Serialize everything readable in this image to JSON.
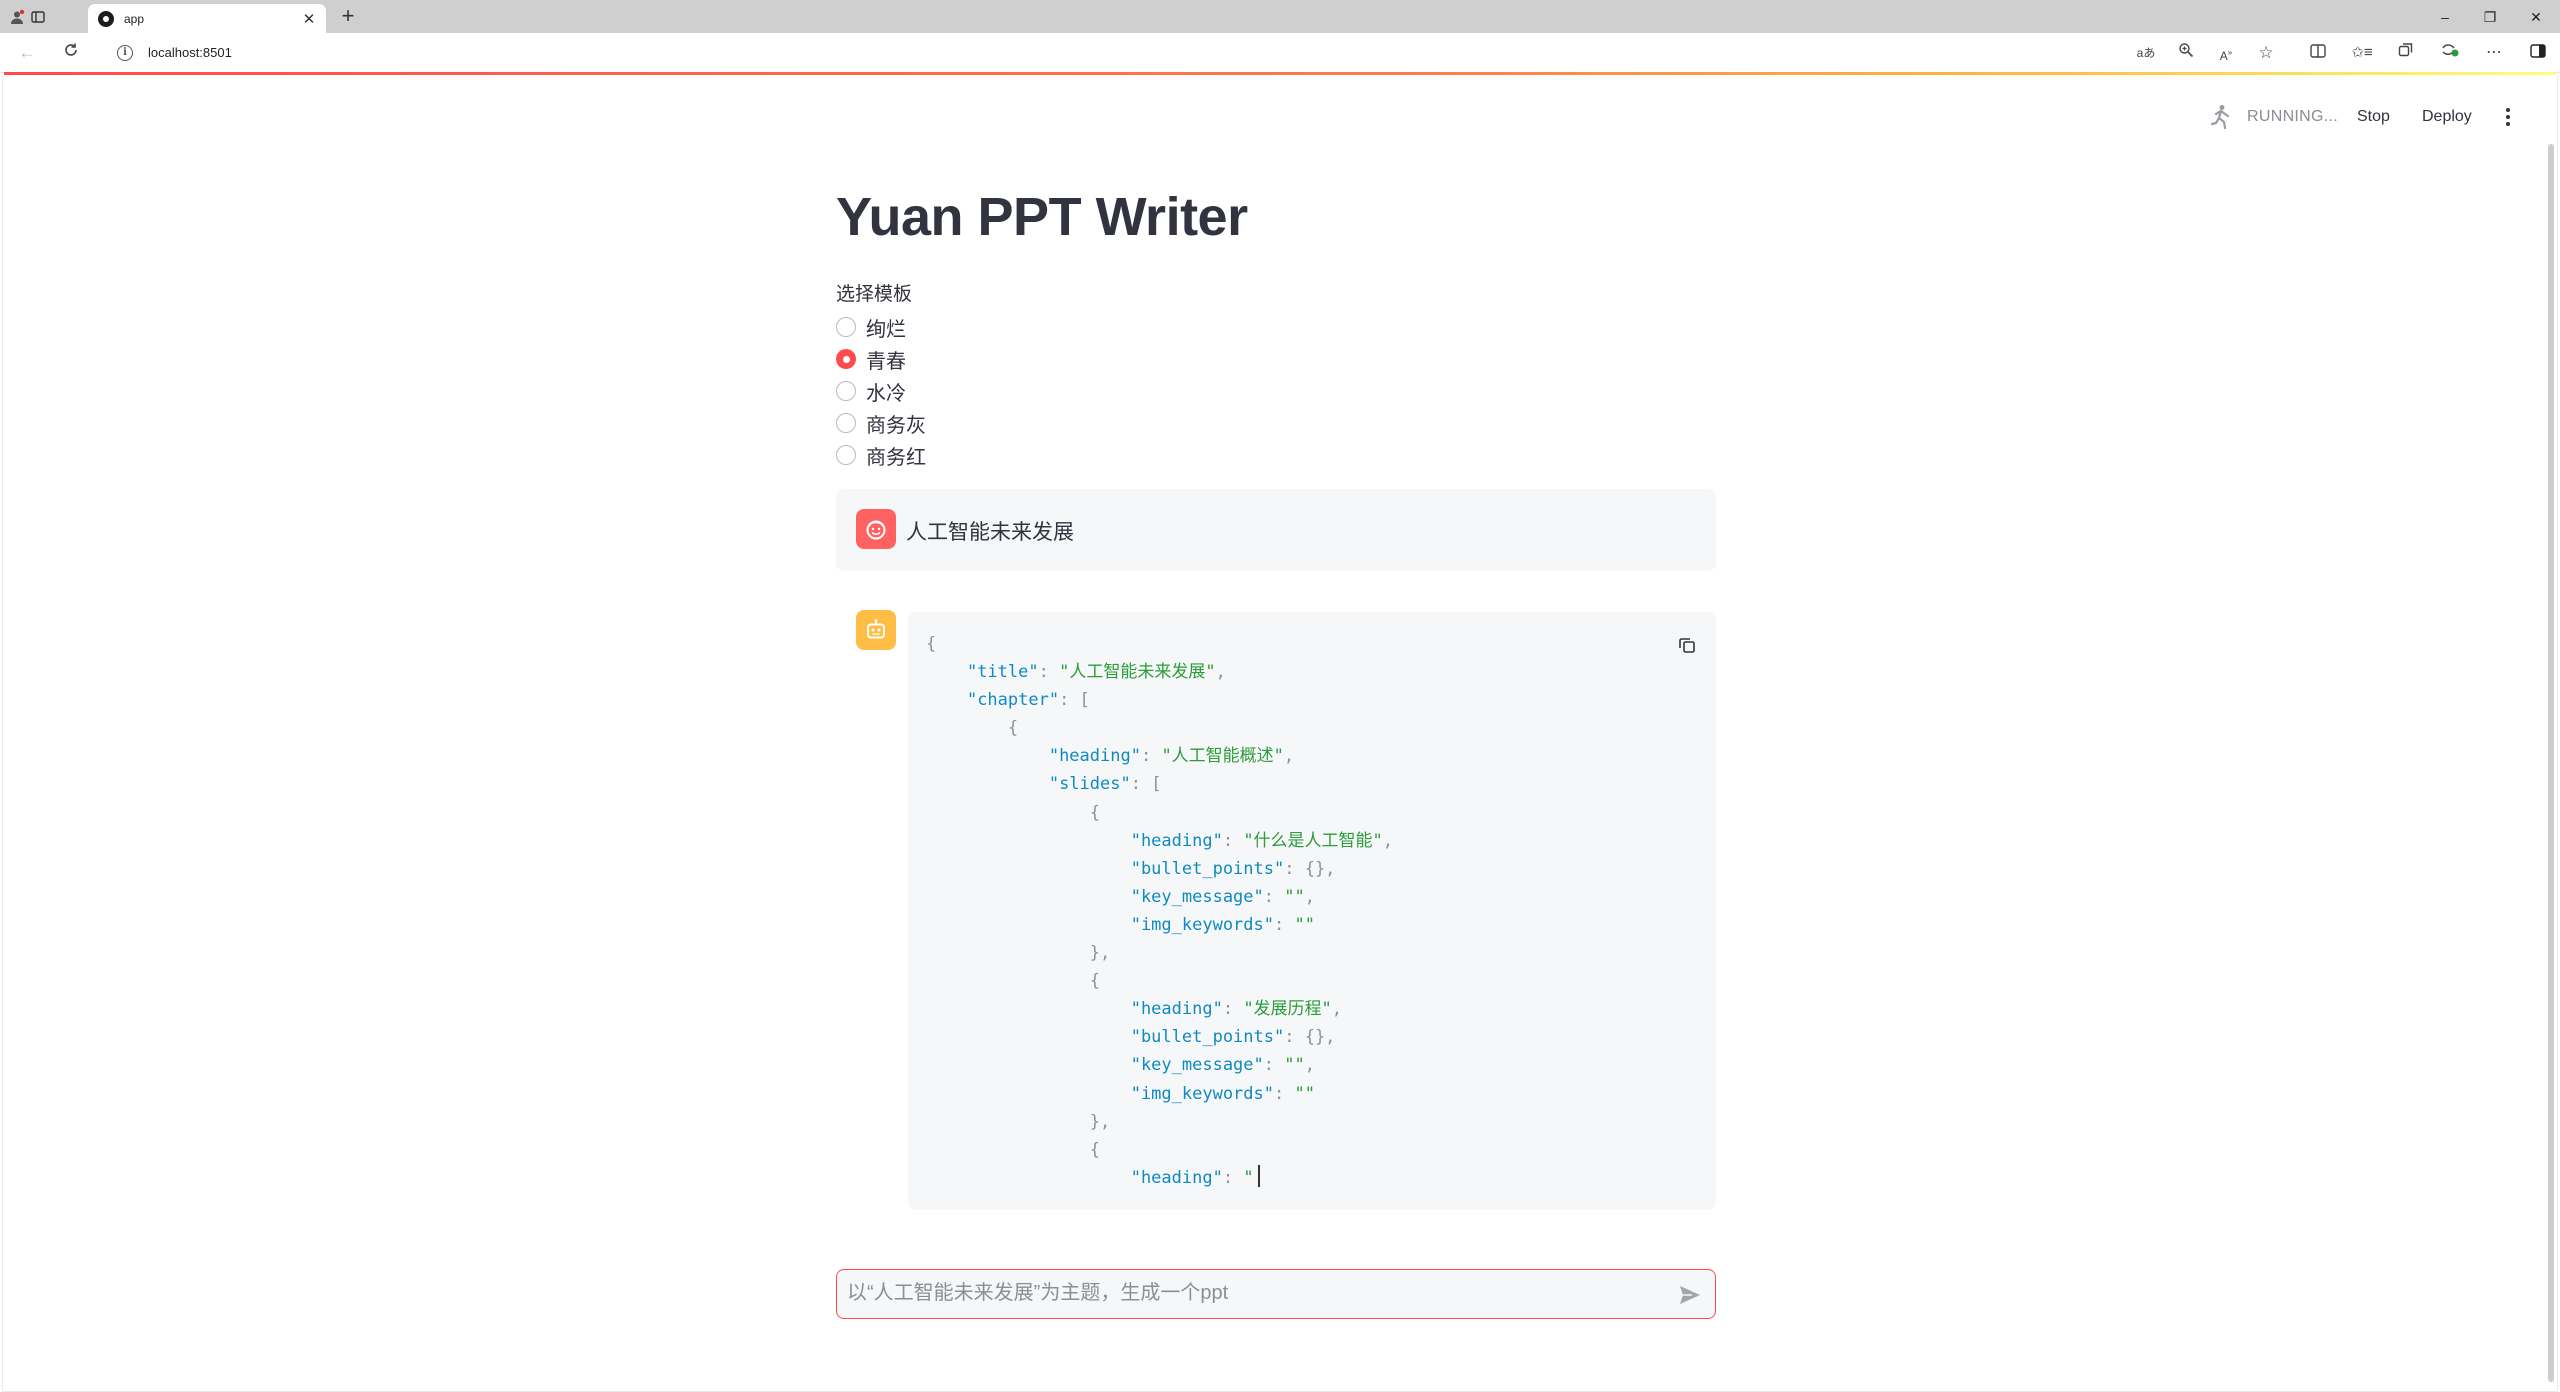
{
  "browser": {
    "tab_title": "app",
    "url": "localhost:8501",
    "tab_close": "✕",
    "new_tab": "+",
    "window_controls": {
      "minimize": "–",
      "restore": "❐",
      "close": "✕"
    }
  },
  "header": {
    "status": "RUNNING...",
    "stop_label": "Stop",
    "deploy_label": "Deploy"
  },
  "main": {
    "title": "Yuan PPT Writer",
    "template_label": "选择模板",
    "templates": [
      {
        "label": "绚烂",
        "checked": false
      },
      {
        "label": "青春",
        "checked": true
      },
      {
        "label": "水冷",
        "checked": false
      },
      {
        "label": "商务灰",
        "checked": false
      },
      {
        "label": "商务红",
        "checked": false
      }
    ]
  },
  "chat": {
    "user_message": "人工智能未来发展",
    "assistant_code": [
      {
        "indent": 0,
        "parts": [
          [
            "p",
            "{"
          ]
        ]
      },
      {
        "indent": 1,
        "parts": [
          [
            "k",
            "\"title\""
          ],
          [
            "p",
            ": "
          ],
          [
            "s",
            "\"人工智能未来发展\""
          ],
          [
            "p",
            ","
          ]
        ]
      },
      {
        "indent": 1,
        "parts": [
          [
            "k",
            "\"chapter\""
          ],
          [
            "p",
            ": ["
          ]
        ]
      },
      {
        "indent": 2,
        "parts": [
          [
            "p",
            "{"
          ]
        ]
      },
      {
        "indent": 3,
        "parts": [
          [
            "k",
            "\"heading\""
          ],
          [
            "p",
            ": "
          ],
          [
            "s",
            "\"人工智能概述\""
          ],
          [
            "p",
            ","
          ]
        ]
      },
      {
        "indent": 3,
        "parts": [
          [
            "k",
            "\"slides\""
          ],
          [
            "p",
            ": ["
          ]
        ]
      },
      {
        "indent": 4,
        "parts": [
          [
            "p",
            "{"
          ]
        ]
      },
      {
        "indent": 5,
        "parts": [
          [
            "k",
            "\"heading\""
          ],
          [
            "p",
            ": "
          ],
          [
            "s",
            "\"什么是人工智能\""
          ],
          [
            "p",
            ","
          ]
        ]
      },
      {
        "indent": 5,
        "parts": [
          [
            "k",
            "\"bullet_points\""
          ],
          [
            "p",
            ": {},"
          ]
        ]
      },
      {
        "indent": 5,
        "parts": [
          [
            "k",
            "\"key_message\""
          ],
          [
            "p",
            ": "
          ],
          [
            "s",
            "\"\""
          ],
          [
            "p",
            ","
          ]
        ]
      },
      {
        "indent": 5,
        "parts": [
          [
            "k",
            "\"img_keywords\""
          ],
          [
            "p",
            ": "
          ],
          [
            "s",
            "\"\""
          ]
        ]
      },
      {
        "indent": 4,
        "parts": [
          [
            "p",
            "},"
          ]
        ]
      },
      {
        "indent": 4,
        "parts": [
          [
            "p",
            "{"
          ]
        ]
      },
      {
        "indent": 5,
        "parts": [
          [
            "k",
            "\"heading\""
          ],
          [
            "p",
            ": "
          ],
          [
            "s",
            "\"发展历程\""
          ],
          [
            "p",
            ","
          ]
        ]
      },
      {
        "indent": 5,
        "parts": [
          [
            "k",
            "\"bullet_points\""
          ],
          [
            "p",
            ": {},"
          ]
        ]
      },
      {
        "indent": 5,
        "parts": [
          [
            "k",
            "\"key_message\""
          ],
          [
            "p",
            ": "
          ],
          [
            "s",
            "\"\""
          ],
          [
            "p",
            ","
          ]
        ]
      },
      {
        "indent": 5,
        "parts": [
          [
            "k",
            "\"img_keywords\""
          ],
          [
            "p",
            ": "
          ],
          [
            "s",
            "\"\""
          ]
        ]
      },
      {
        "indent": 4,
        "parts": [
          [
            "p",
            "},"
          ]
        ]
      },
      {
        "indent": 4,
        "parts": [
          [
            "p",
            "{"
          ]
        ]
      },
      {
        "indent": 5,
        "parts": [
          [
            "k",
            "\"heading\""
          ],
          [
            "p",
            ": "
          ],
          [
            "s",
            "\""
          ]
        ],
        "caret": true
      }
    ],
    "input_placeholder": "以“人工智能未来发展”为主题，生成一个ppt",
    "input_value": ""
  },
  "colors": {
    "primary": "#ff4b4b",
    "user_avatar": "#ff6262",
    "assistant_avatar": "#ffbd45",
    "code_key": "#0f8ac0",
    "code_string": "#2c9d3a",
    "code_background": "#f6f7f9"
  },
  "icons": {
    "profile": "profile-icon",
    "workspaces": "workspaces-icon",
    "back": "back-arrow-icon",
    "reload": "reload-icon",
    "site_info": "info-icon",
    "running": "running-person-icon",
    "menu": "vertical-dots-icon",
    "copy": "copy-icon",
    "send": "send-icon",
    "user_avatar": "user-face-icon",
    "assistant_avatar": "robot-face-icon"
  }
}
